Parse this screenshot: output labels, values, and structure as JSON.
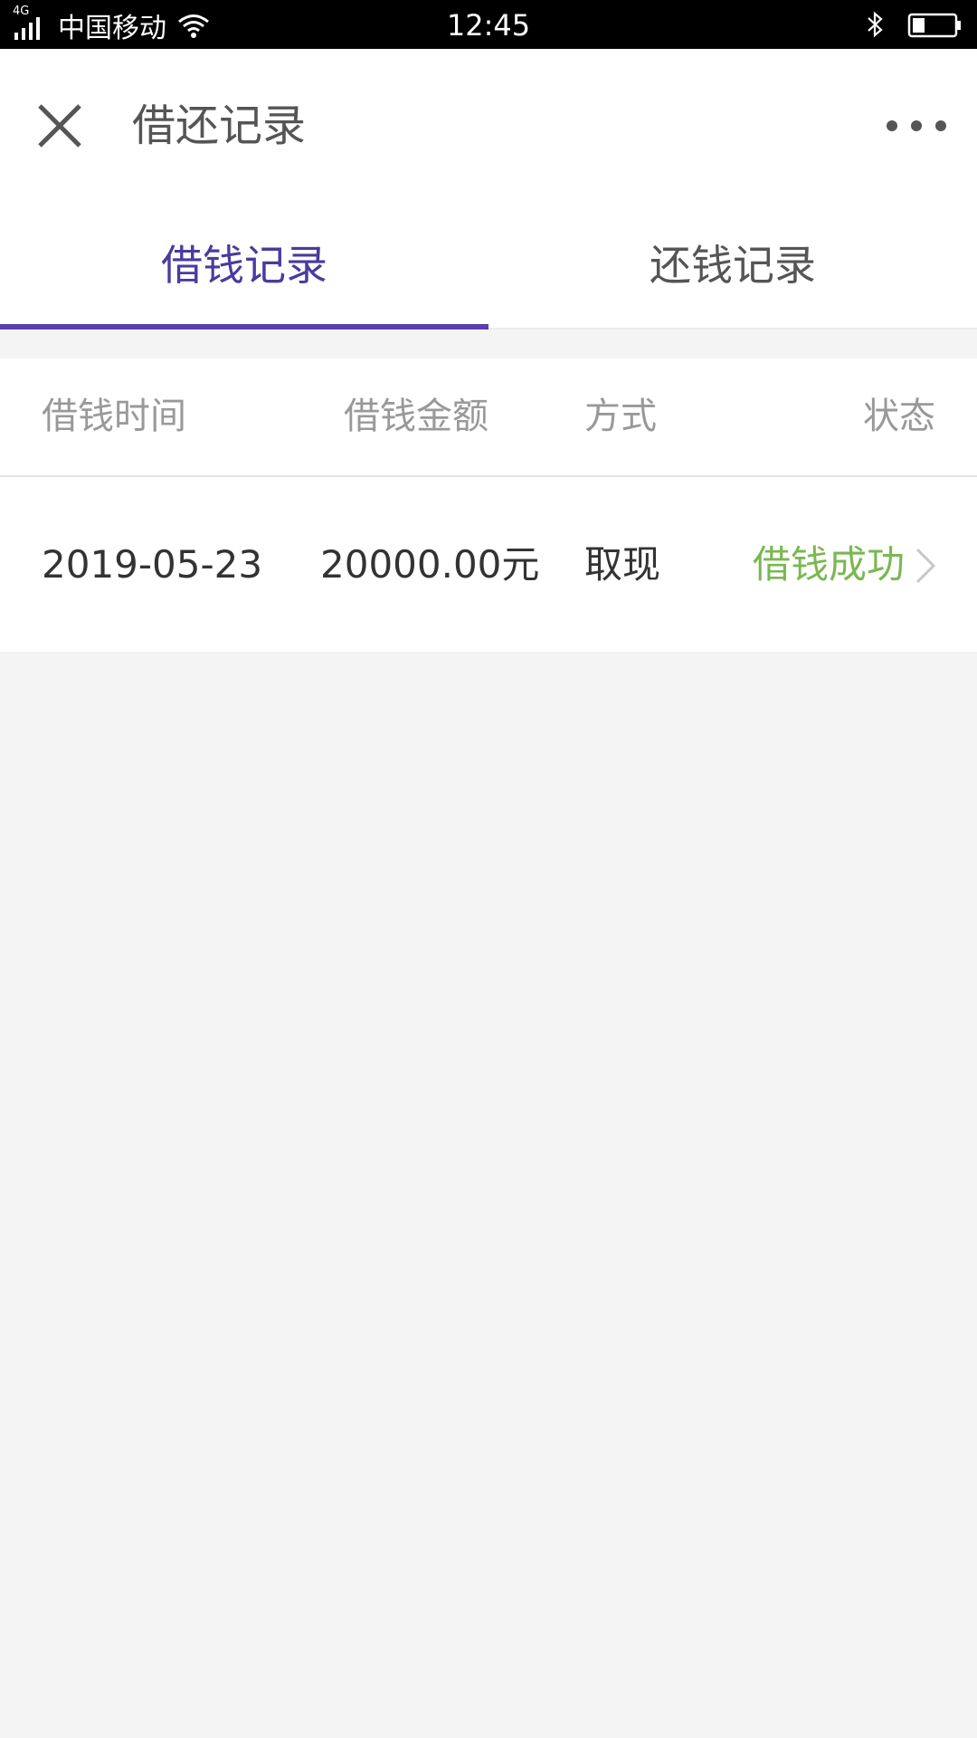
{
  "status_bar": {
    "network_type": "4G",
    "carrier": "中国移动",
    "time": "12:45"
  },
  "header": {
    "title": "借还记录",
    "icons": [
      "close-icon",
      "more-icon"
    ]
  },
  "tabs": [
    {
      "label": "借钱记录",
      "active": true
    },
    {
      "label": "还钱记录",
      "active": false
    }
  ],
  "table": {
    "headers": [
      "借钱时间",
      "借钱金额",
      "方式",
      "状态"
    ],
    "rows": [
      {
        "time": "2019-05-23",
        "amount": "20000.00元",
        "method": "取现",
        "status": "借钱成功"
      }
    ]
  },
  "colors": {
    "accent": "#5a3fb0",
    "success": "#7ab852",
    "background": "#f4f4f4"
  }
}
